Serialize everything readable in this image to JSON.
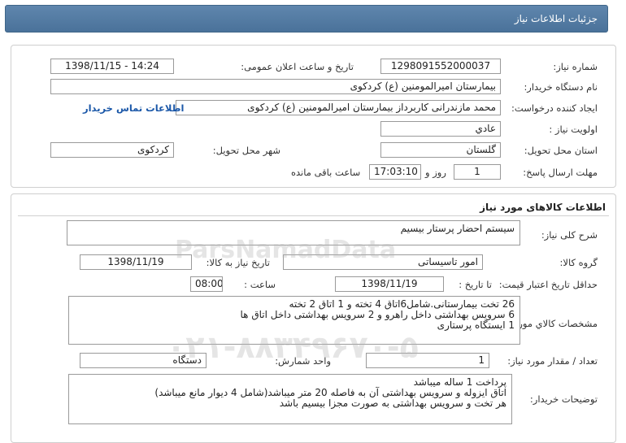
{
  "header": {
    "title": "جزئیات اطلاعات نیاز"
  },
  "need_info": {
    "need_number_label": "شماره نیاز:",
    "need_number": "1298091552000037",
    "announce_label": "تاریخ و ساعت اعلان عمومی:",
    "announce_value": "1398/11/15 - 14:24",
    "buyer_label": "نام دستگاه خریدار:",
    "buyer_value": "بیمارستان امیرالمومنین (ع) کردکوی",
    "creator_label": "ایجاد کننده درخواست:",
    "creator_value": "محمد مازندرانی کاربرداز بیمارستان امیرالمومنین (ع) کردکوی",
    "contact_link": "اطلاعات تماس خریدار",
    "priority_label": "اولویت نیاز :",
    "priority_value": "عادي",
    "province_label": "استان محل تحویل:",
    "province_value": "گلستان",
    "city_label": "شهر محل تحویل:",
    "city_value": "کردکوی",
    "deadline_label": "مهلت ارسال پاسخ:",
    "deadline_days": "1",
    "days_label": "روز و",
    "deadline_time": "17:03:10",
    "remaining_label": "ساعت باقی مانده"
  },
  "goods": {
    "section_title": "اطلاعات کالاهای مورد نیاز",
    "general_desc_label": "شرح کلی نیاز:",
    "general_desc_value": "سیستم احضار پرستار بیسیم",
    "group_label": "گروه کالا:",
    "group_value": "امور تاسیساتی",
    "need_date_label": "تاریخ نیاز به کالا:",
    "need_date_value": "1398/11/19",
    "min_valid_label": "حداقل تاریخ اعتبار قیمت:",
    "to_date_label": "تا تاریخ :",
    "to_date_value": "1398/11/19",
    "hour_label": "ساعت :",
    "hour_value": "08:00",
    "specs_label": "مشخصات کالاي مورد نیاز:",
    "specs_lines": [
      "26 تخت بیمارستانی.شامل6اتاق 4 تخته و 1 اتاق 2 تخته",
      "6 سرویس بهداشتی داخل راهرو و 2 سرویس بهداشتی داخل اتاق ها",
      "1 ایستگاه پرستاری"
    ],
    "qty_label": "تعداد / مقدار مورد نیاز:",
    "qty_value": "1",
    "unit_label": "واحد شمارش:",
    "unit_value": "دستگاه",
    "buyer_notes_label": "توضیحات خریدار:",
    "buyer_notes_lines": [
      "پرداخت 1 ساله میباشد",
      "اتاق ایزوله و سرویس بهداشتی آن به فاصله 20 متر میباشد(شامل 4 دیوار مانع میباشد)",
      "هر تخت و سرویس بهداشتی به صورت مجزا بیسیم باشد"
    ]
  },
  "watermark": {
    "brand": "ParsNamadData",
    "phone": "۰۲۱-۸۸۳۴۹۶۷۰-۵"
  },
  "colors": {
    "header_bg": "#4f77a0",
    "link": "#1a57a8"
  }
}
